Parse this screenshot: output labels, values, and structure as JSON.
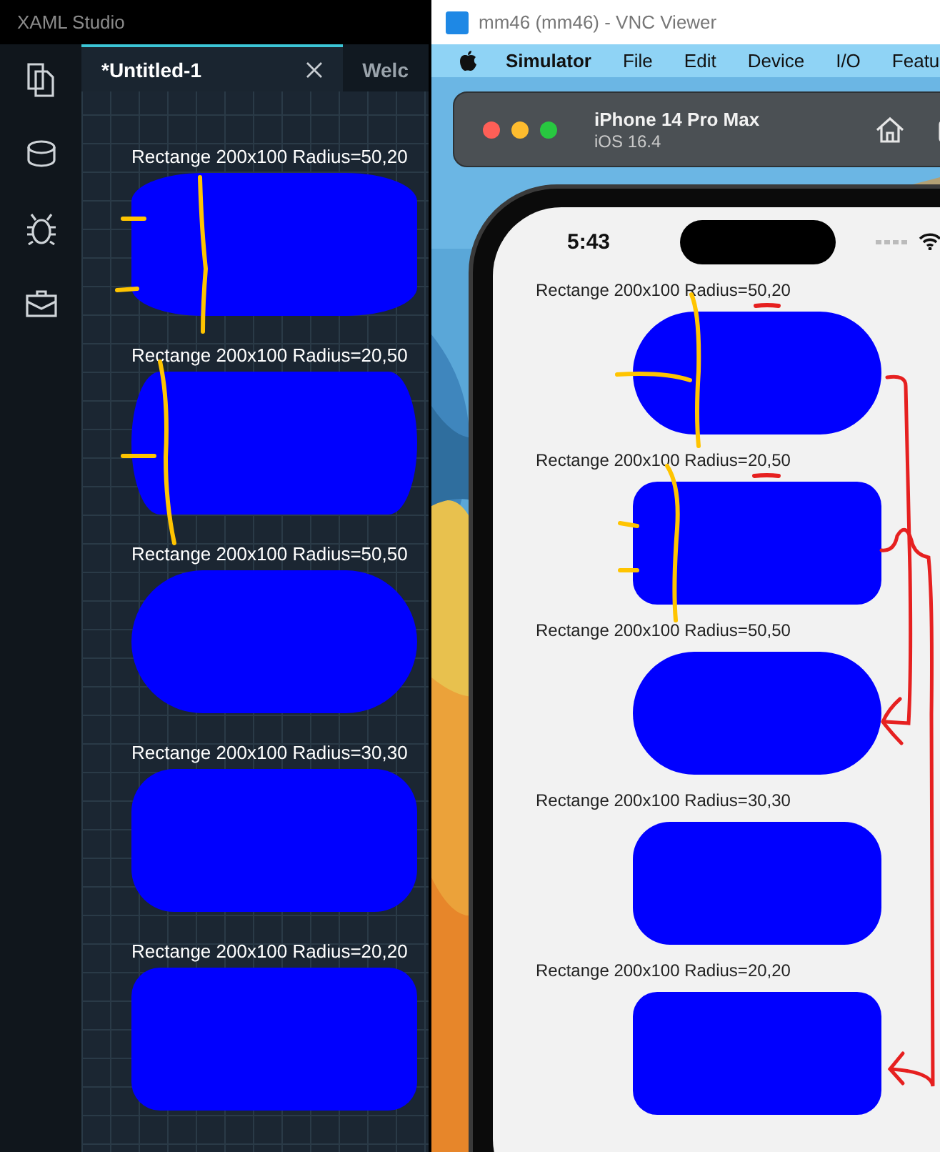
{
  "xaml_studio": {
    "title": "XAML Studio",
    "tabs": [
      {
        "label": "*Untitled-1",
        "selected": true,
        "closable": true
      },
      {
        "label": "Welc",
        "selected": false,
        "closable": false
      }
    ],
    "preview": [
      {
        "label": "Rectange 200x100 Radius=50,20",
        "kind": "wide"
      },
      {
        "label": "Rectange 200x100 Radius=20,50",
        "kind": "tall"
      },
      {
        "label": "Rectange 200x100 Radius=50,50",
        "kind": "pill"
      },
      {
        "label": "Rectange 200x100 Radius=30,30",
        "kind": "medium"
      },
      {
        "label": "Rectange 200x100 Radius=20,20",
        "kind": "small"
      }
    ]
  },
  "vnc_viewer": {
    "title": "mm46 (mm46) - VNC Viewer",
    "menu": [
      {
        "label": "Simulator",
        "kind": "app"
      },
      {
        "label": "File",
        "kind": "menu"
      },
      {
        "label": "Edit",
        "kind": "menu"
      },
      {
        "label": "Device",
        "kind": "menu"
      },
      {
        "label": "I/O",
        "kind": "menu"
      },
      {
        "label": "Featu",
        "kind": "menu"
      }
    ],
    "device": "iPhone 14 Pro Max",
    "os": "iOS 16.4",
    "time": "5:43",
    "screen": [
      {
        "label": "Rectange 200x100 Radius=50,20",
        "kind": "wide"
      },
      {
        "label": "Rectange 200x100 Radius=20,50",
        "kind": "tall"
      },
      {
        "label": "Rectange 200x100 Radius=50,50",
        "kind": "pill"
      },
      {
        "label": "Rectange 200x100 Radius=30,30",
        "kind": "medium"
      },
      {
        "label": "Rectange 200x100 Radius=20,20",
        "kind": "small"
      }
    ]
  }
}
